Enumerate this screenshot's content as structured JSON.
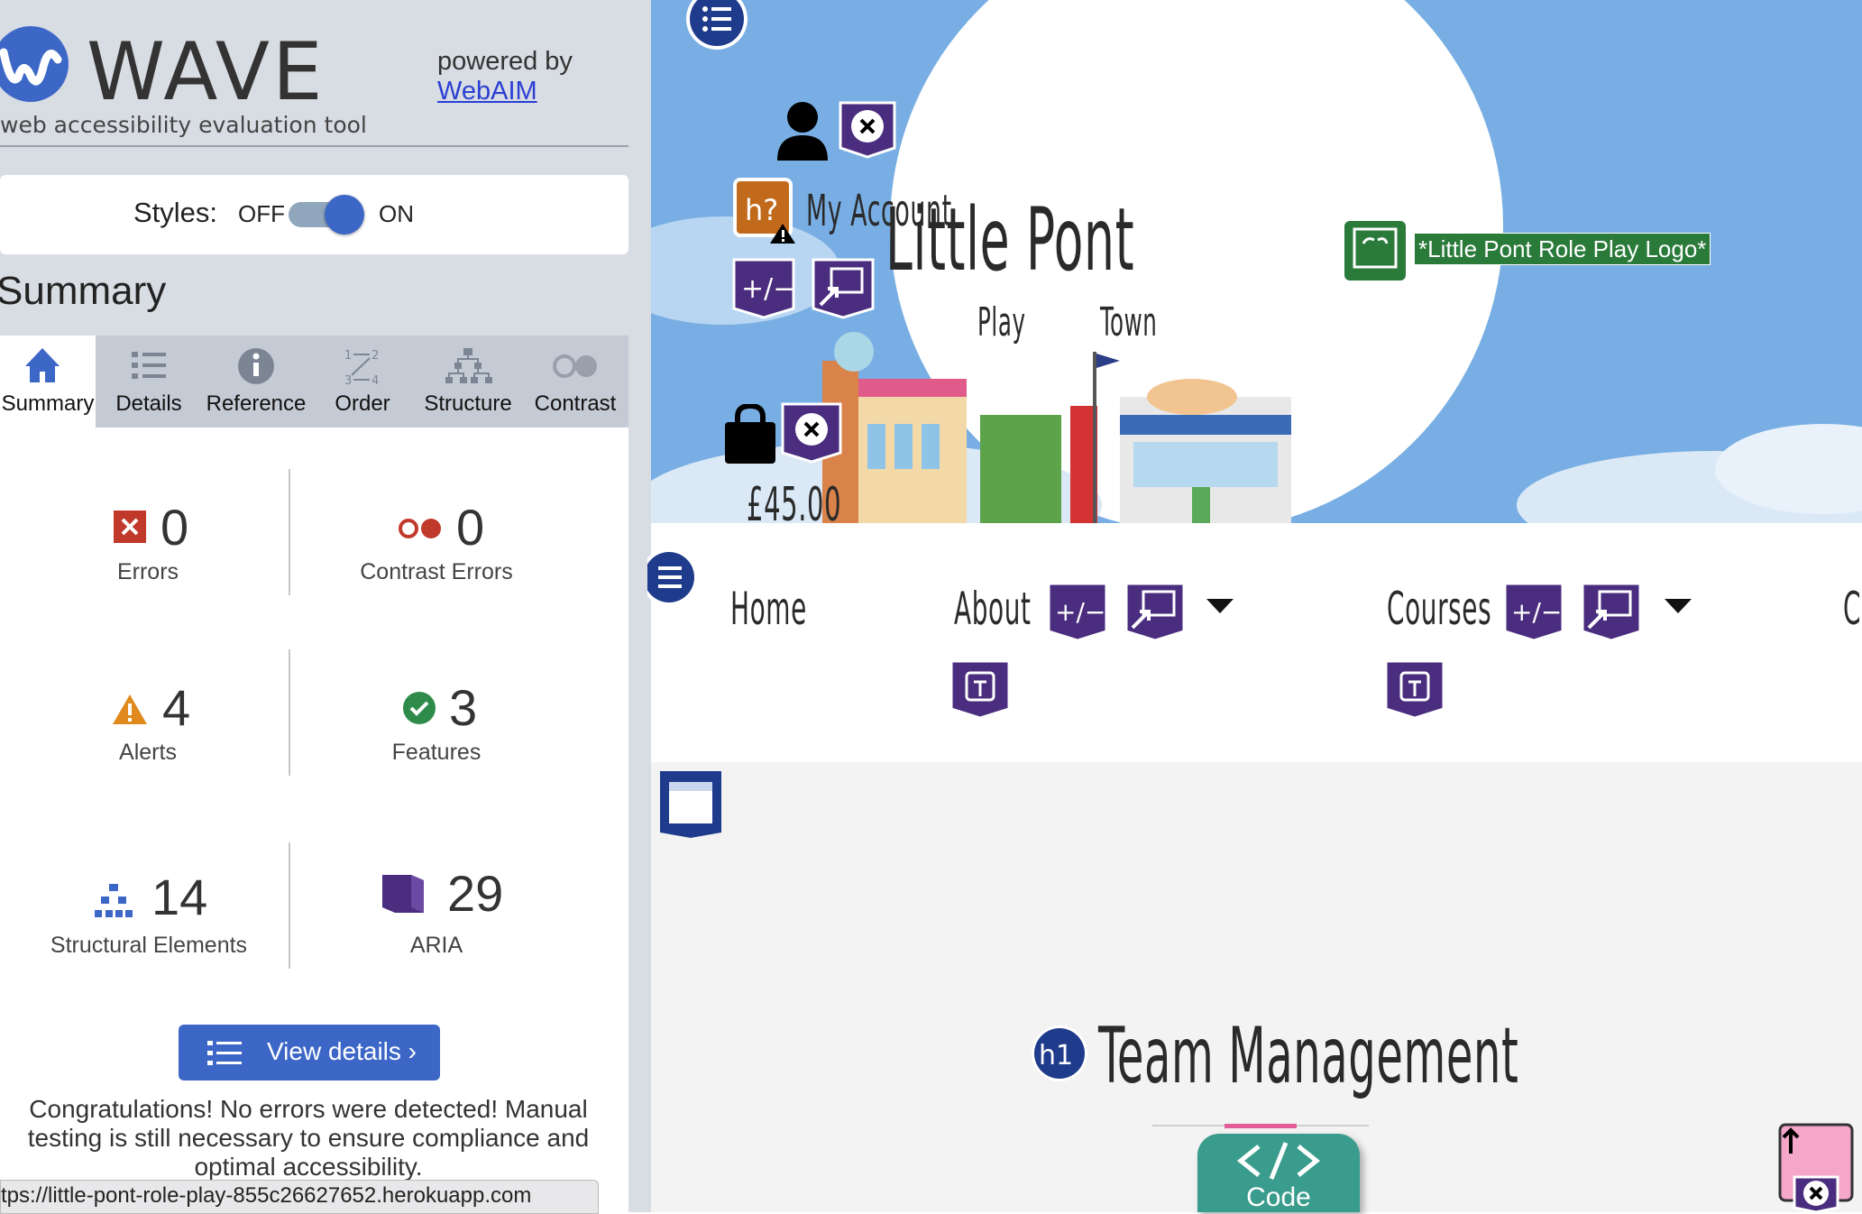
{
  "wave": {
    "logo_text": "WAVE",
    "subtitle": "web accessibility evaluation tool",
    "powered_by": "powered by",
    "webaim_link": "WebAIM",
    "styles_label": "Styles:",
    "styles_off": "OFF",
    "styles_on": "ON",
    "summary_heading": "Summary",
    "tabs": [
      {
        "label": "Summary",
        "icon": "home-icon"
      },
      {
        "label": "Details",
        "icon": "list-icon"
      },
      {
        "label": "Reference",
        "icon": "info-icon"
      },
      {
        "label": "Order",
        "icon": "order-icon"
      },
      {
        "label": "Structure",
        "icon": "structure-icon"
      },
      {
        "label": "Contrast",
        "icon": "contrast-icon"
      }
    ],
    "stats": {
      "errors": {
        "count": "0",
        "label": "Errors"
      },
      "contrast_errors": {
        "count": "0",
        "label": "Contrast Errors"
      },
      "alerts": {
        "count": "4",
        "label": "Alerts"
      },
      "features": {
        "count": "3",
        "label": "Features"
      },
      "structural": {
        "count": "14",
        "label": "Structural Elements"
      },
      "aria": {
        "count": "29",
        "label": "ARIA"
      }
    },
    "view_details": "View details ›",
    "congrats_line1": "Congratulations! No errors were detected! Manual",
    "congrats_line2": "testing is still necessary to ensure compliance and",
    "congrats_line3": "optimal accessibility.",
    "status_url": "tps://little-pont-role-play-855c26627652.herokuapp.com"
  },
  "page": {
    "account_label": "My Account",
    "site_title": "Little Pont",
    "site_sub_play": "Play",
    "site_sub_town": "Town",
    "logo_alt": "*Little Pont Role Play Logo*",
    "price": "£45.00",
    "nav": [
      "Home",
      "About",
      "Courses",
      "C"
    ],
    "heading_badge": "h1",
    "heading": "Team Management",
    "code_label": "Code",
    "help_badge": "h?"
  },
  "colors": {
    "wave_blue": "#3c67c7",
    "aria_purple": "#4a2d7f",
    "hero_sky": "#78aee3",
    "feature_green": "#2a7a3a",
    "alert_orange": "#c26a1c"
  }
}
